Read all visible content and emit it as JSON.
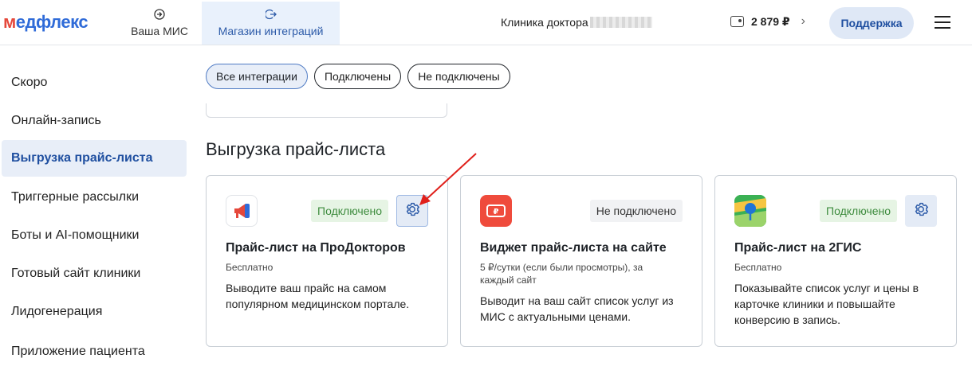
{
  "header": {
    "logo": {
      "m": "м",
      "rest": "едфлекс"
    },
    "tabs": [
      {
        "label": "Ваша МИС",
        "icon": "login-icon"
      },
      {
        "label": "Магазин интеграций",
        "icon": "logout-icon"
      }
    ],
    "clinic": "Клиника доктора",
    "balance": "2 879 ₽",
    "support_label": "Поддержка"
  },
  "sidebar": {
    "items": [
      {
        "label": "Скоро"
      },
      {
        "label": "Онлайн-запись"
      },
      {
        "label": "Выгрузка прайс-листа",
        "active": true
      },
      {
        "label": "Триггерные рассылки"
      },
      {
        "label": "Боты и AI-помощники"
      },
      {
        "label": "Готовый сайт клиники"
      },
      {
        "label": "Лидогенерация"
      },
      {
        "label": "Приложение пациента"
      }
    ]
  },
  "filters": [
    {
      "label": "Все интеграции",
      "active": true
    },
    {
      "label": "Подключены"
    },
    {
      "label": "Не подключены"
    }
  ],
  "section_title": "Выгрузка прайс-листа",
  "cards": [
    {
      "title": "Прайс-лист на ПроДокторов",
      "price": "Бесплатно",
      "description": "Выводите ваш прайс на самом популярном медицинском портале.",
      "status": "Подключено",
      "status_state": "connected",
      "has_settings": true,
      "logo_icon": "megaphone-icon"
    },
    {
      "title": "Виджет прайс-листа на сайте",
      "price": "5 ₽/сутки (если были просмотры), за каждый сайт",
      "description": "Выводит на ваш сайт список услуг из МИС с актуальными ценами.",
      "status": "Не подключено",
      "status_state": "not-connected",
      "has_settings": false,
      "logo_icon": "price-tag-icon"
    },
    {
      "title": "Прайс-лист на 2ГИС",
      "price": "Бесплатно",
      "description": "Показывайте список услуг и цены в карточке клиники и повышайте конверсию в запись.",
      "status": "Подключено",
      "status_state": "connected",
      "has_settings": true,
      "logo_icon": "2gis-map-icon"
    }
  ],
  "colors": {
    "brand_blue": "#2f6bd8",
    "brand_red": "#e5483b",
    "connected_green": "#3d8b3d",
    "annotation_arrow": "#e0201b"
  }
}
